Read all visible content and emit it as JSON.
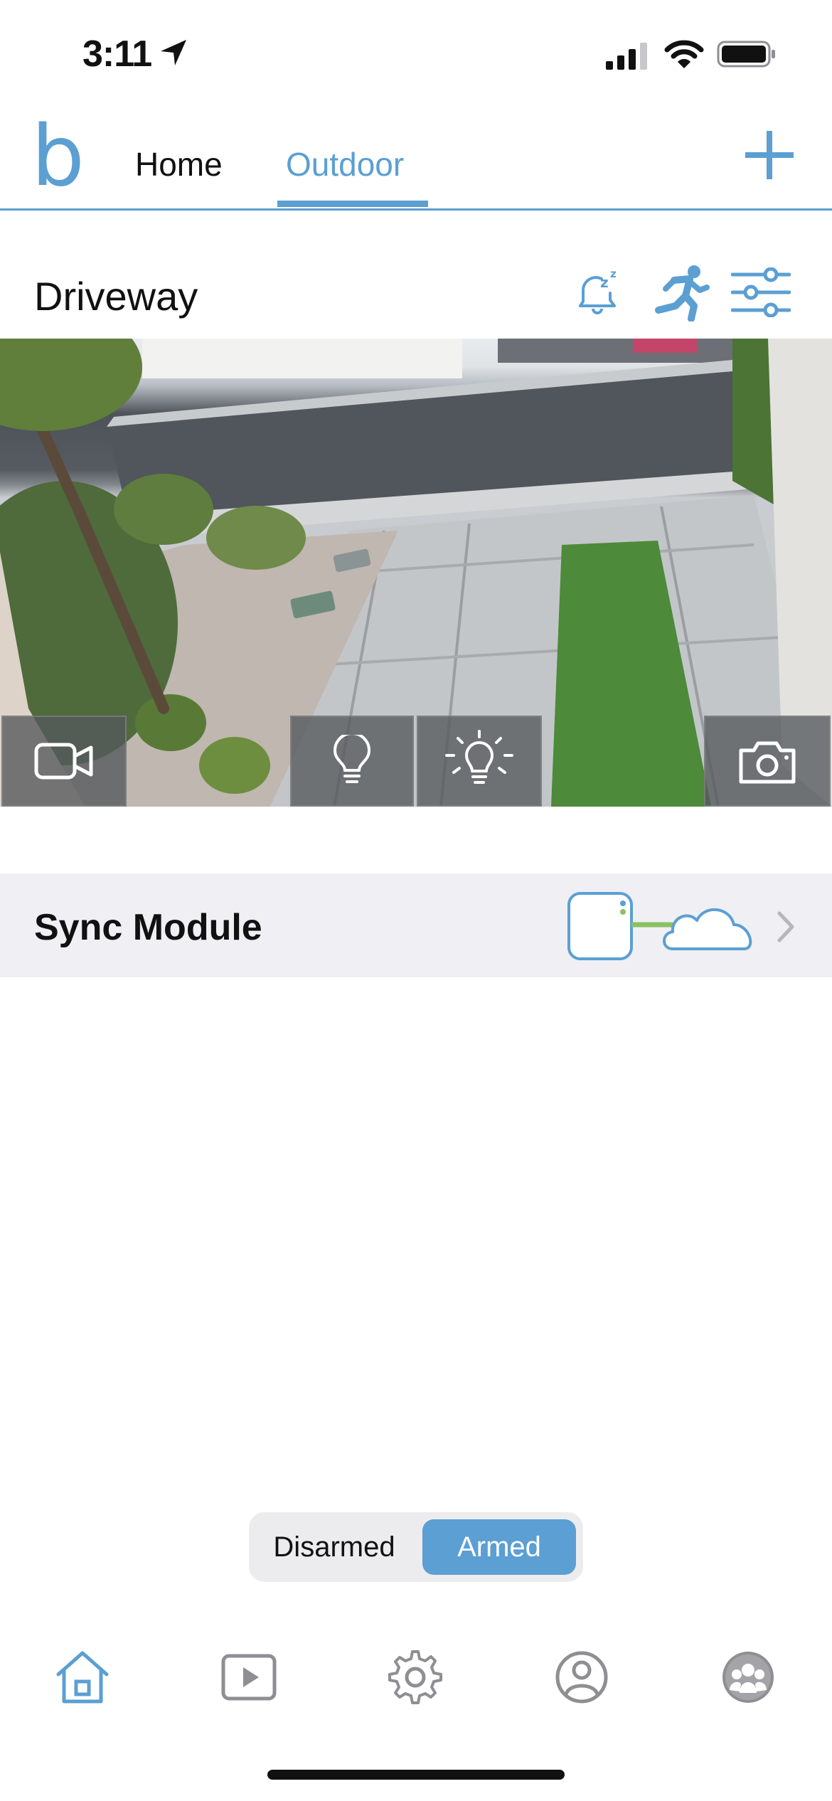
{
  "status_bar": {
    "time": "3:11"
  },
  "header": {
    "logo": "b",
    "tabs": [
      {
        "label": "Home"
      },
      {
        "label": "Outdoor"
      }
    ],
    "active_tab": "Outdoor",
    "add_icon": "plus-icon"
  },
  "camera": {
    "name": "Driveway",
    "header_icons": [
      "snooze-bell-icon",
      "motion-runner-icon",
      "sliders-icon"
    ],
    "feed_buttons": [
      "video-camera-icon",
      "light-bulb-icon",
      "bright-light-icon",
      "camera-snapshot-icon"
    ]
  },
  "sync_module": {
    "label": "Sync Module"
  },
  "arm_toggle": {
    "disarmed_label": "Disarmed",
    "armed_label": "Armed",
    "selected": "Armed"
  },
  "bottom_nav": {
    "items": [
      "home-icon",
      "clips-icon",
      "settings-gear-icon",
      "account-icon",
      "shared-users-icon"
    ],
    "active": "home-icon"
  },
  "colors": {
    "accent": "#5b9fd3",
    "sync_link": "#8ac262",
    "sync_row_bg": "#efeff4"
  }
}
